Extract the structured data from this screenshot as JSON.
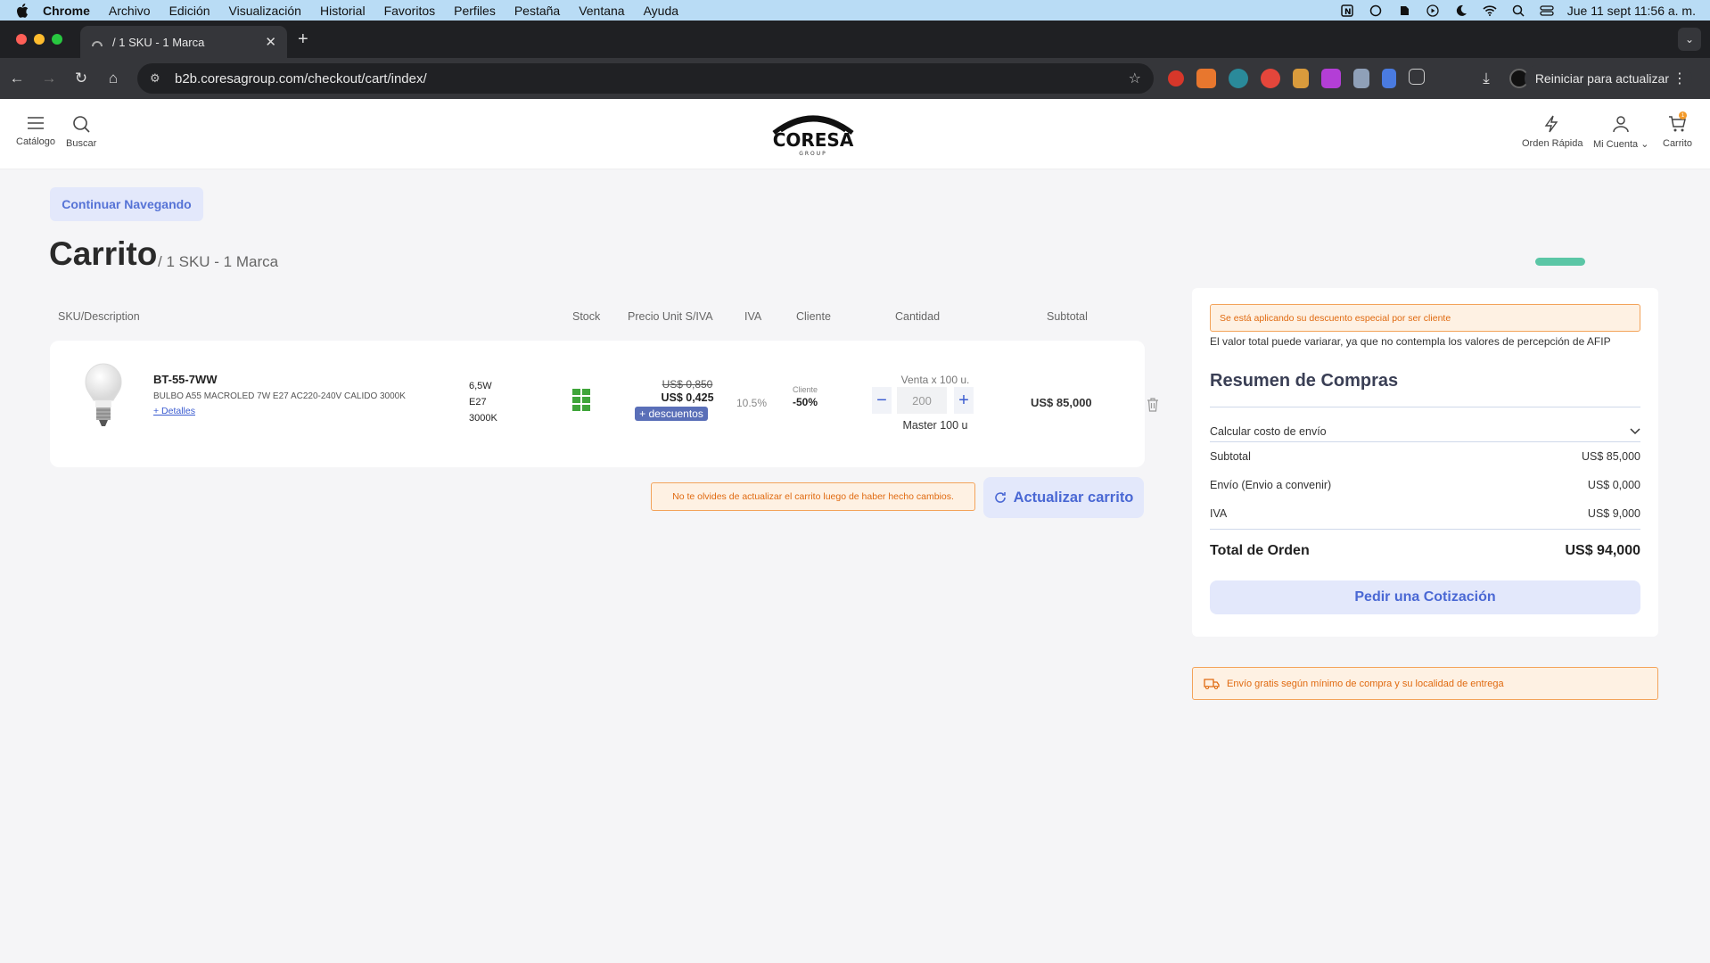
{
  "mac_menu": {
    "app": "Chrome",
    "items": [
      "Archivo",
      "Edición",
      "Visualización",
      "Historial",
      "Favoritos",
      "Perfiles",
      "Pestaña",
      "Ventana",
      "Ayuda"
    ],
    "datetime": "Jue 11 sept  11:56 a. m."
  },
  "browser": {
    "tab_title": "/ 1 SKU - 1 Marca",
    "url": "b2b.coresagroup.com/checkout/cart/index/",
    "restart_label": "Reiniciar para actualizar"
  },
  "header": {
    "catalog_label": "Catálogo",
    "search_label": "Buscar",
    "logo_text": "CORESA",
    "logo_sub": "GROUP",
    "quick_order_label": "Orden Rápida",
    "account_label": "Mi Cuenta",
    "cart_label": "Carrito",
    "cart_count": "1"
  },
  "page": {
    "continue_label": "Continuar Navegando",
    "title": "Carrito",
    "subtitle": "/ 1 SKU - 1 Marca"
  },
  "table": {
    "headers": {
      "sku": "SKU/Description",
      "stock": "Stock",
      "price": "Precio Unit S/IVA",
      "iva": "IVA",
      "client": "Cliente",
      "qty": "Cantidad",
      "subtotal": "Subtotal"
    },
    "item": {
      "sku": "BT-55-7WW",
      "description": "BULBO A55 MACROLED 7W E27 AC220-240V CALIDO 3000K",
      "details_link": "+ Detalles",
      "spec1": "6,5W",
      "spec2": "E27",
      "spec3": "3000K",
      "price_old": "US$ 0,850",
      "price_new": "US$ 0,425",
      "discounts_badge": "+ descuentos",
      "iva": "10.5%",
      "client_label": "Cliente",
      "client_discount": "-50%",
      "sale_unit": "Venta x 100 u.",
      "qty": "200",
      "master": "Master 100 u",
      "subtotal": "US$ 85,000"
    }
  },
  "cart_actions": {
    "update_notice": "No te olvides de actualizar el carrito luego de haber hecho cambios.",
    "update_label": "Actualizar carrito"
  },
  "summary": {
    "discount_notice": "Se está aplicando su descuento especial por ser cliente",
    "afip_note": "El valor total puede variarar, ya que no contempla los valores de percepción de AFIP",
    "title": "Resumen de Compras",
    "ship_calc_label": "Calcular costo de envío",
    "subtotal_label": "Subtotal",
    "subtotal_value": "US$ 85,000",
    "shipping_label": "Envío (Envio a convenir)",
    "shipping_value": "US$ 0,000",
    "iva_label": "IVA",
    "iva_value": "US$ 9,000",
    "total_label": "Total de Orden",
    "total_value": "US$ 94,000",
    "quote_label": "Pedir una Cotización"
  },
  "shipping_notice": "Envío gratis según mínimo de compra y su localidad de entrega",
  "colors": {
    "accent": "#4a68d4",
    "accent_bg": "#e3e8fb",
    "warning_text": "#e06a10",
    "warning_bg": "#fef1e3",
    "stock_green": "#3fa53a"
  }
}
